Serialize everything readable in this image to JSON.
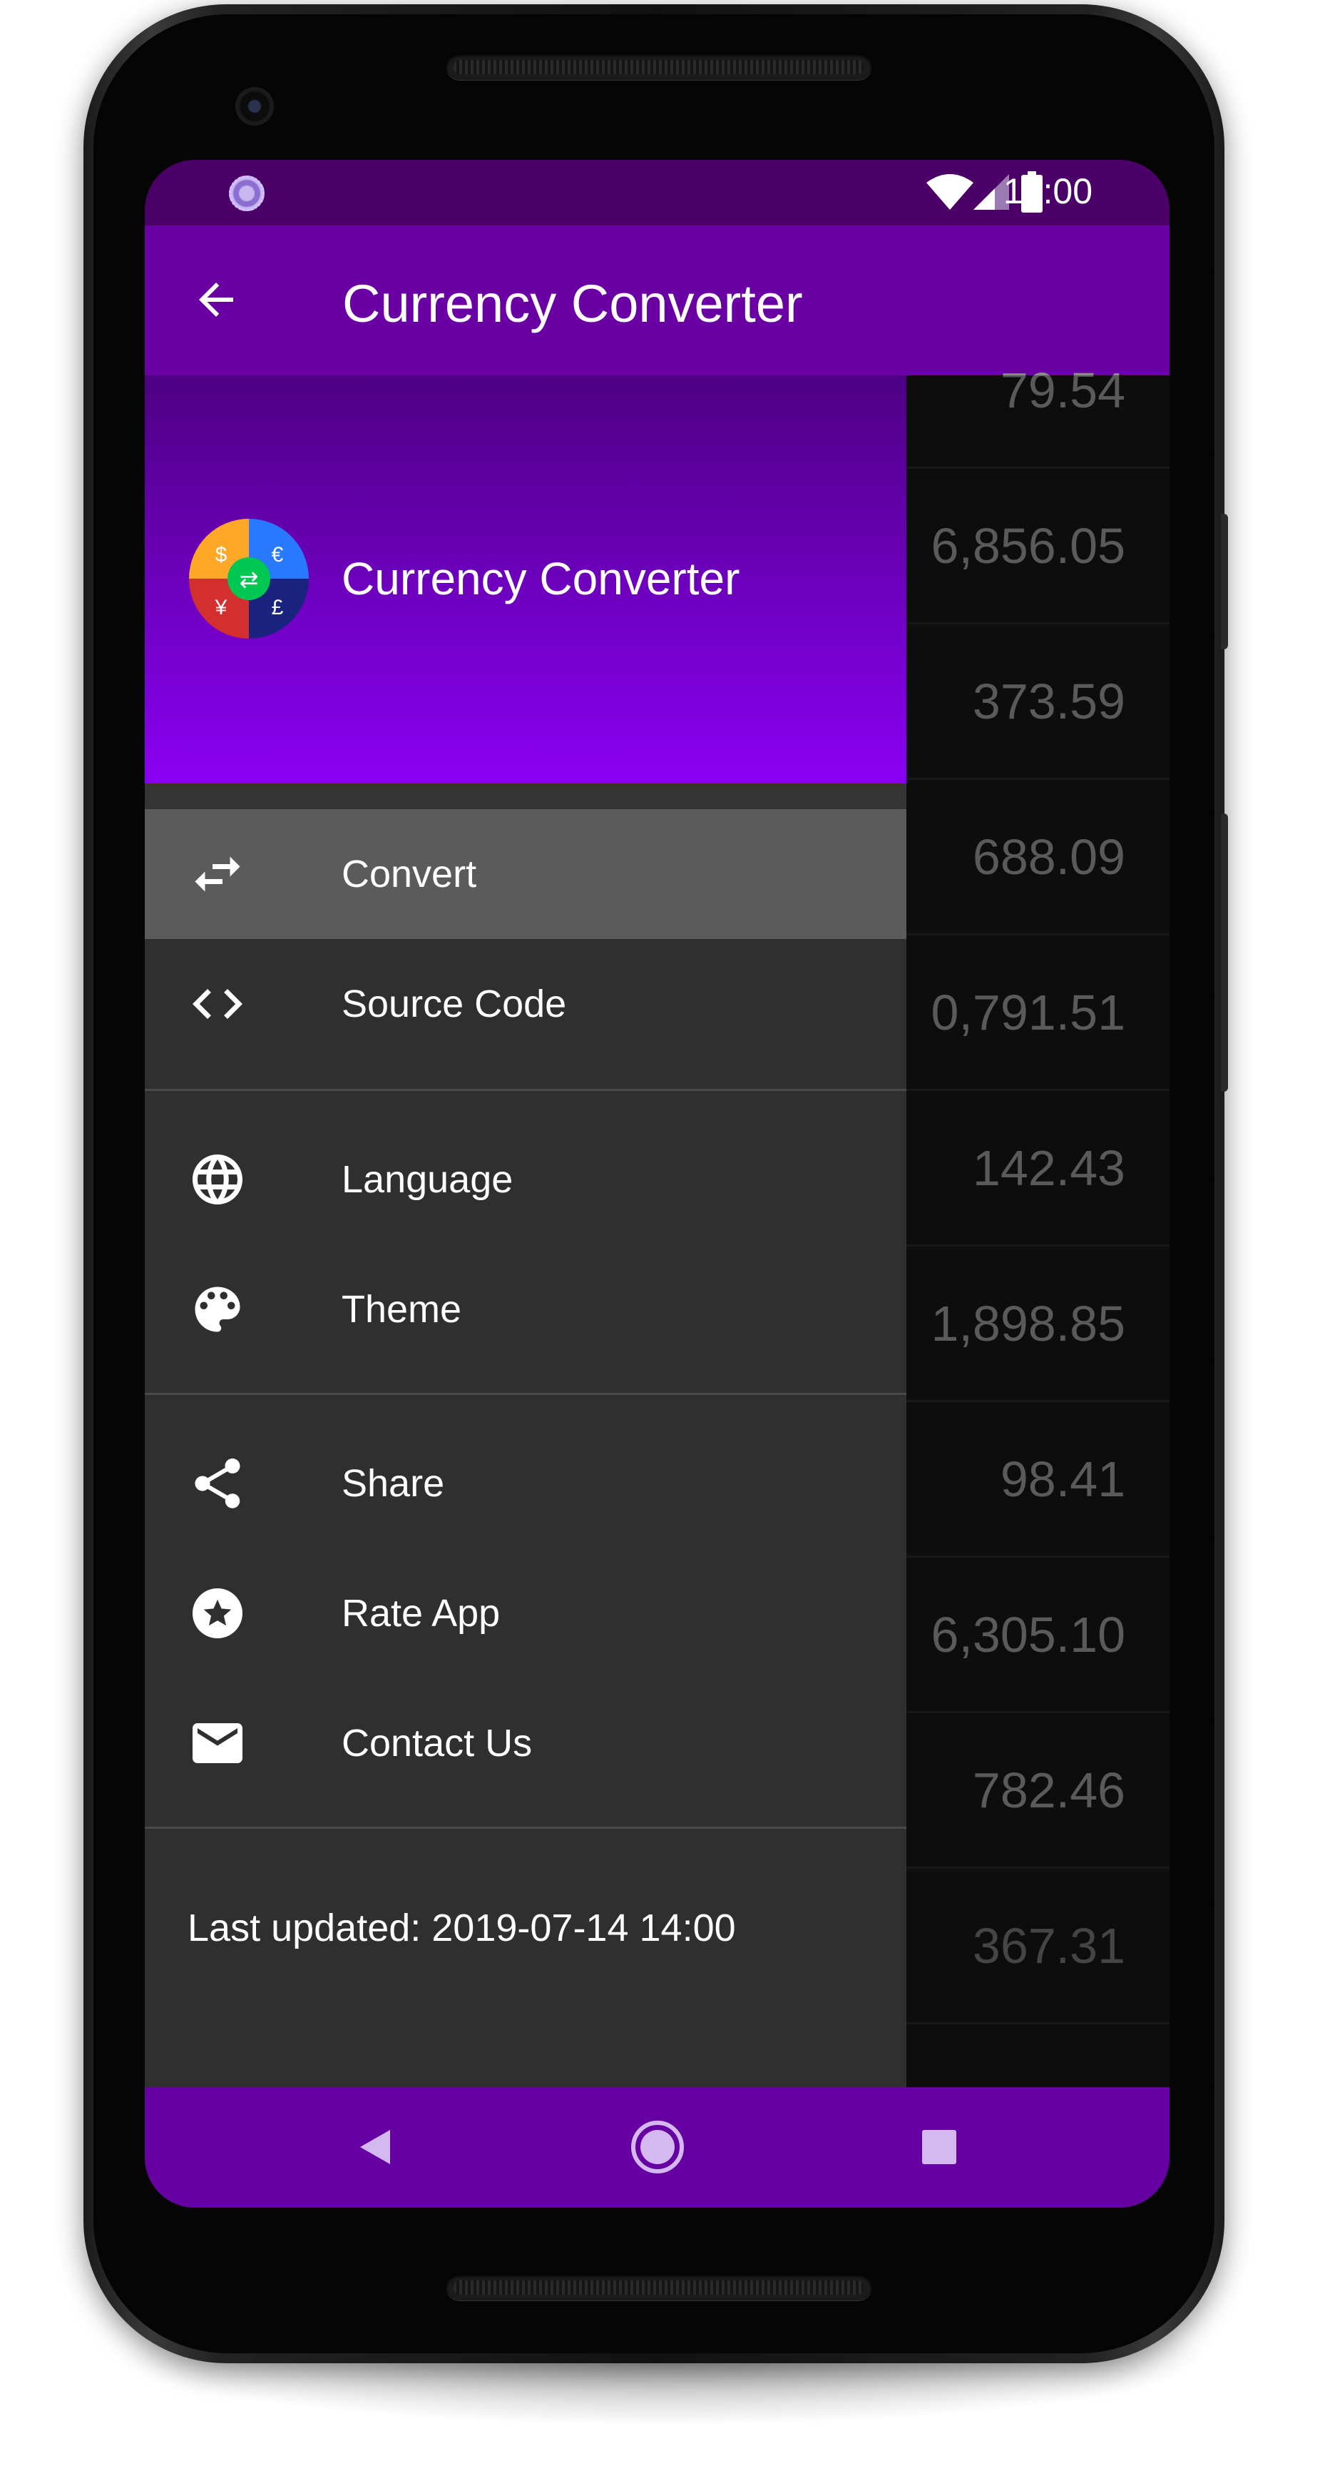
{
  "status_bar": {
    "time": "12:00"
  },
  "app_bar": {
    "title": "Currency Converter"
  },
  "list": {
    "values": [
      "79.54",
      "6,856.05",
      "373.59",
      "688.09",
      "0,791.51",
      "142.43",
      "1,898.85",
      "98.41",
      "6,305.10",
      "782.46",
      "367.31"
    ]
  },
  "drawer": {
    "header_title": "Currency Converter",
    "logo_symbols": [
      "$",
      "€",
      "¥",
      "£",
      "⇄"
    ],
    "items": [
      {
        "label": "Convert",
        "icon": "swap-arrows-icon",
        "active": true
      },
      {
        "label": "Source Code",
        "icon": "code-brackets-icon"
      },
      {
        "label": "Language",
        "icon": "globe-icon"
      },
      {
        "label": "Theme",
        "icon": "palette-icon"
      },
      {
        "label": "Share",
        "icon": "share-icon"
      },
      {
        "label": "Rate App",
        "icon": "star-circle-icon"
      },
      {
        "label": "Contact Us",
        "icon": "mail-icon"
      }
    ],
    "last_updated": "Last updated: 2019-07-14 14:00"
  },
  "colors": {
    "primary": "#6a00a4",
    "primary_dark": "#4b0067",
    "drawer_bg": "#2f2f2f",
    "active_item": "#5b5b5b"
  }
}
